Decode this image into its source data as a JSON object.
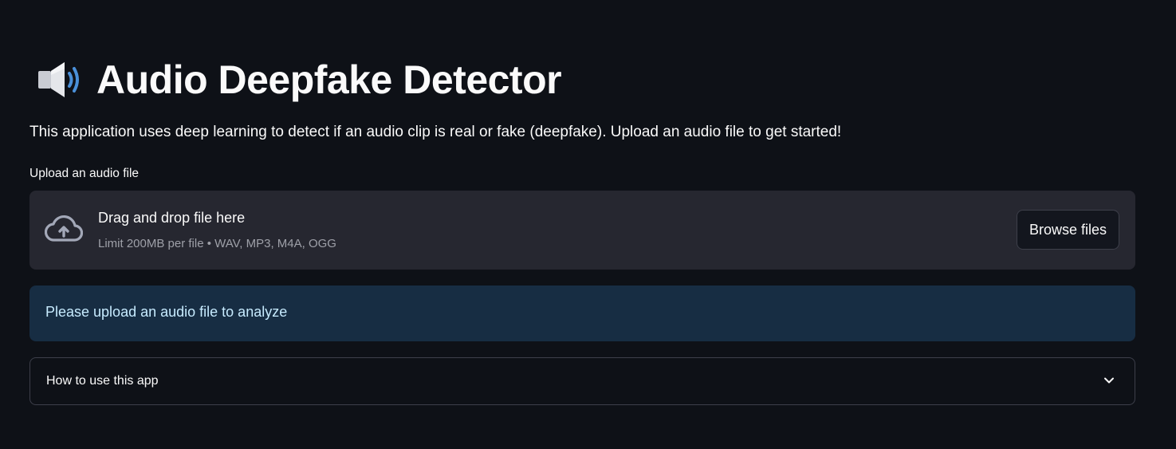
{
  "header": {
    "title": "Audio Deepfake Detector",
    "icon": "speaker-high-volume-icon"
  },
  "intro": {
    "text": "This application uses deep learning to detect if an audio clip is real or fake (deepfake). Upload an audio file to get started!"
  },
  "uploader": {
    "label": "Upload an audio file",
    "drop_title": "Drag and drop file here",
    "limit_text": "Limit 200MB per file • WAV, MP3, M4A, OGG",
    "browse_label": "Browse files",
    "icon": "cloud-upload-icon"
  },
  "info": {
    "text": "Please upload an audio file to analyze",
    "background": "#172d43",
    "text_color": "#c7ebff"
  },
  "expander": {
    "label": "How to use this app",
    "icon": "chevron-down-icon",
    "expanded": false
  },
  "colors": {
    "background": "#0e1117",
    "surface": "#262730",
    "text": "#fafafa",
    "muted": "#9ea0a8",
    "border": "#3d3f4a"
  }
}
